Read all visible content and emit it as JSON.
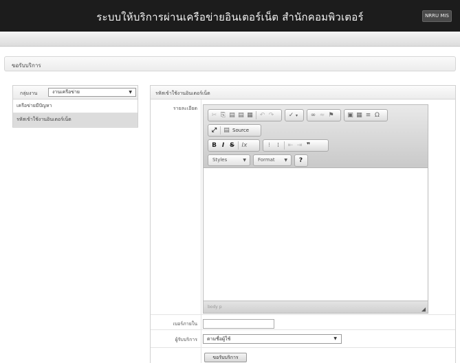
{
  "header": {
    "title": "ระบบให้บริการผ่านเครือข่ายอินเตอร์เน็ต สำนักคอมพิวเตอร์",
    "user_button": "NRRU MIS"
  },
  "section": {
    "title": "ขอรับบริการ"
  },
  "left_panel": {
    "group_label": "กลุ่มงาน",
    "group_value": "งานเครือข่าย",
    "items": [
      {
        "label": "เครือข่ายมีปัญหา",
        "active": false
      },
      {
        "label": "รหัสเข้าใช้งานอินเตอร์เน็ต",
        "active": true
      }
    ]
  },
  "right_panel": {
    "title": "รหัสเข้าใช้งานอินเตอร์เน็ต",
    "details_label": "รายละเอียด",
    "phone_label": "เบอร์ภายใน",
    "phone_value": "",
    "recipient_label": "ผู้รับบริการ",
    "recipient_value": "ตามชื่อผู้ใช้",
    "submit_label": "ขอรับบริการ"
  },
  "editor": {
    "source_label": "Source",
    "styles_label": "Styles",
    "format_label": "Format",
    "status_path": "body p",
    "toolbar_icons": [
      "cut-icon",
      "copy-icon",
      "paste-icon",
      "paste-text-icon",
      "paste-word-icon",
      "undo-icon",
      "redo-icon",
      "spellcheck-icon",
      "link-icon",
      "unlink-icon",
      "anchor-icon",
      "image-icon",
      "table-icon",
      "horizontal-rule-icon",
      "special-char-icon",
      "maximize-icon",
      "source-icon",
      "bold-icon",
      "italic-icon",
      "strike-icon",
      "remove-format-icon",
      "numbered-list-icon",
      "bulleted-list-icon",
      "outdent-icon",
      "indent-icon",
      "blockquote-icon",
      "help-icon"
    ]
  }
}
